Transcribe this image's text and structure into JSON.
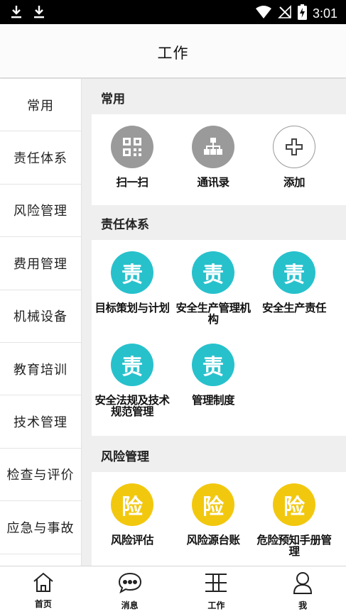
{
  "status_bar": {
    "time": "3:01"
  },
  "header": {
    "title": "工作"
  },
  "sidebar": {
    "items": [
      {
        "label": "常用"
      },
      {
        "label": "责任体系"
      },
      {
        "label": "风险管理"
      },
      {
        "label": "费用管理"
      },
      {
        "label": "机械设备"
      },
      {
        "label": "教育培训"
      },
      {
        "label": "技术管理"
      },
      {
        "label": "检查与评价"
      },
      {
        "label": "应急与事故"
      }
    ]
  },
  "sections": [
    {
      "title": "常用",
      "items": [
        {
          "label": "扫一扫",
          "icon": "qr-code-icon"
        },
        {
          "label": "通讯录",
          "icon": "org-chart-icon"
        },
        {
          "label": "添加",
          "icon": "plus-icon"
        }
      ]
    },
    {
      "title": "责任体系",
      "glyph": "责",
      "color": "#27c1cc",
      "items": [
        {
          "label": "目标策划与计划"
        },
        {
          "label": "安全生产管理机构"
        },
        {
          "label": "安全生产责任"
        },
        {
          "label": "安全法规及技术规范管理"
        },
        {
          "label": "管理制度"
        }
      ]
    },
    {
      "title": "风险管理",
      "glyph": "险",
      "color": "#f2c80f",
      "items": [
        {
          "label": "风险评估"
        },
        {
          "label": "风险源台账"
        },
        {
          "label": "危险预知手册管理"
        }
      ]
    }
  ],
  "tabbar": {
    "items": [
      {
        "label": "首页",
        "icon": "home-icon"
      },
      {
        "label": "消息",
        "icon": "message-icon"
      },
      {
        "label": "工作",
        "icon": "work-icon"
      },
      {
        "label": "我",
        "icon": "user-icon"
      }
    ]
  }
}
